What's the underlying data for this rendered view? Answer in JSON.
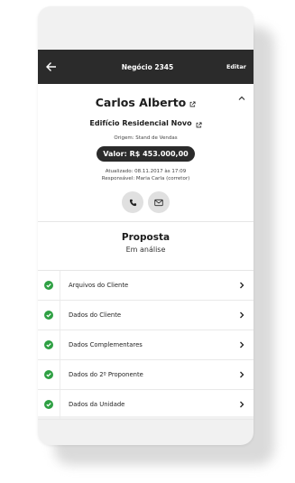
{
  "topbar": {
    "title": "Negócio 2345",
    "edit_label": "Editar"
  },
  "client": {
    "name": "Carlos Alberto",
    "building": "Edifício Residencial Novo",
    "origin": "Origem: Stand de Vendas",
    "value": "Valor: R$ 453.000,00",
    "updated": "Atualizado: 08.11.2017 às 17:09",
    "responsible": "Responsável: Maria Carla (corretor)"
  },
  "proposal": {
    "title": "Proposta",
    "status": "Em análise"
  },
  "items": [
    {
      "label": "Arquivos do Cliente"
    },
    {
      "label": "Dados do Cliente"
    },
    {
      "label": "Dados Complementares"
    },
    {
      "label": "Dados do 2º Proponente"
    },
    {
      "label": "Dados da Unidade"
    }
  ],
  "colors": {
    "topbar": "#2b2b2b",
    "check": "#2ea043",
    "pill": "#2b2b2b"
  }
}
